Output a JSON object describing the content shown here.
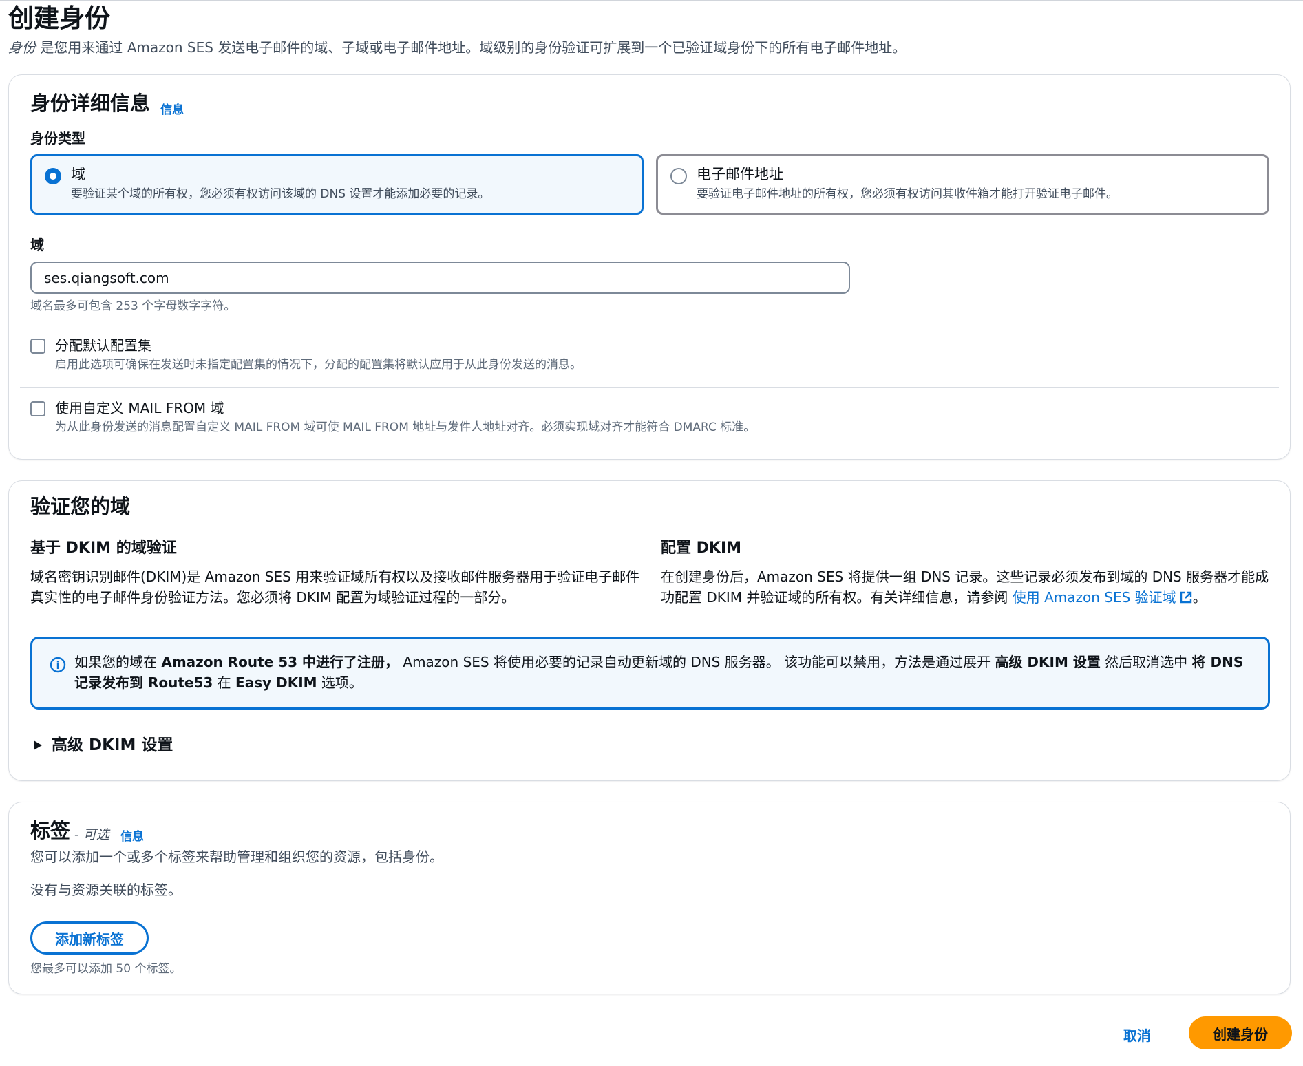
{
  "header": {
    "title": "创建身份",
    "desc_italic": "身份",
    "desc_rest": " 是您用来通过 Amazon SES 发送电子邮件的域、子域或电子邮件地址。域级别的身份验证可扩展到一个已验证域身份下的所有电子邮件地址。"
  },
  "identity_details": {
    "title": "身份详细信息",
    "info_link": "信息",
    "type_label": "身份类型",
    "options": [
      {
        "title": "域",
        "desc": "要验证某个域的所有权，您必须有权访问该域的 DNS 设置才能添加必要的记录。",
        "selected": true
      },
      {
        "title": "电子邮件地址",
        "desc": "要验证电子邮件地址的所有权，您必须有权访问其收件箱才能打开验证电子邮件。",
        "selected": false
      }
    ],
    "domain_label": "域",
    "domain_value": "ses.qiangsoft.com",
    "domain_hint": "域名最多可包含 253 个字母数字字符。",
    "config_set_title": "分配默认配置集",
    "config_set_desc": "启用此选项可确保在发送时未指定配置集的情况下，分配的配置集将默认应用于从此身份发送的消息。",
    "mail_from_title": "使用自定义 MAIL FROM 域",
    "mail_from_desc": "为从此身份发送的消息配置自定义 MAIL FROM 域可使 MAIL FROM 地址与发件人地址对齐。必须实现域对齐才能符合 DMARC 标准。"
  },
  "verify": {
    "title": "验证您的域",
    "dkim_heading": "基于 DKIM 的域验证",
    "dkim_text": "域名密钥识别邮件(DKIM)是 Amazon SES 用来验证域所有权以及接收邮件服务器用于验证电子邮件真实性的电子邮件身份验证方法。您必须将 DKIM 配置为域验证过程的一部分。",
    "config_heading": "配置 DKIM",
    "config_text": "在创建身份后，Amazon SES 将提供一组 DNS 记录。这些记录必须发布到域的 DNS 服务器才能成功配置 DKIM 并验证域的所有权。有关详细信息，请参阅 ",
    "config_link": "使用 Amazon SES 验证域",
    "config_end": "。",
    "alert": {
      "p1": "如果您的域在 ",
      "b1": "Amazon Route 53 中进行了注册，",
      "p2": " Amazon SES 将使用必要的记录自动更新域的 DNS 服务器。 该功能可以禁用，方法是通过展开 ",
      "b2": "高级 DKIM 设置",
      "p3": " 然后取消选中 ",
      "b3": "将 DNS 记录发布到 Route53",
      "p4": " 在 ",
      "b4": "Easy DKIM",
      "p5": " 选项。"
    },
    "advanced_label": "高级 DKIM 设置"
  },
  "tags": {
    "title": "标签",
    "optional": "- 可选",
    "info_link": "信息",
    "desc": "您可以添加一个或多个标签来帮助管理和组织您的资源，包括身份。",
    "empty": "没有与资源关联的标签。",
    "add_button": "添加新标签",
    "limit": "您最多可以添加 50 个标签。"
  },
  "footer": {
    "cancel": "取消",
    "create": "创建身份"
  },
  "colors": {
    "link": "#0972d3",
    "primary_button": "#ff9900",
    "selected_tile_bg": "#f2f8fd"
  }
}
